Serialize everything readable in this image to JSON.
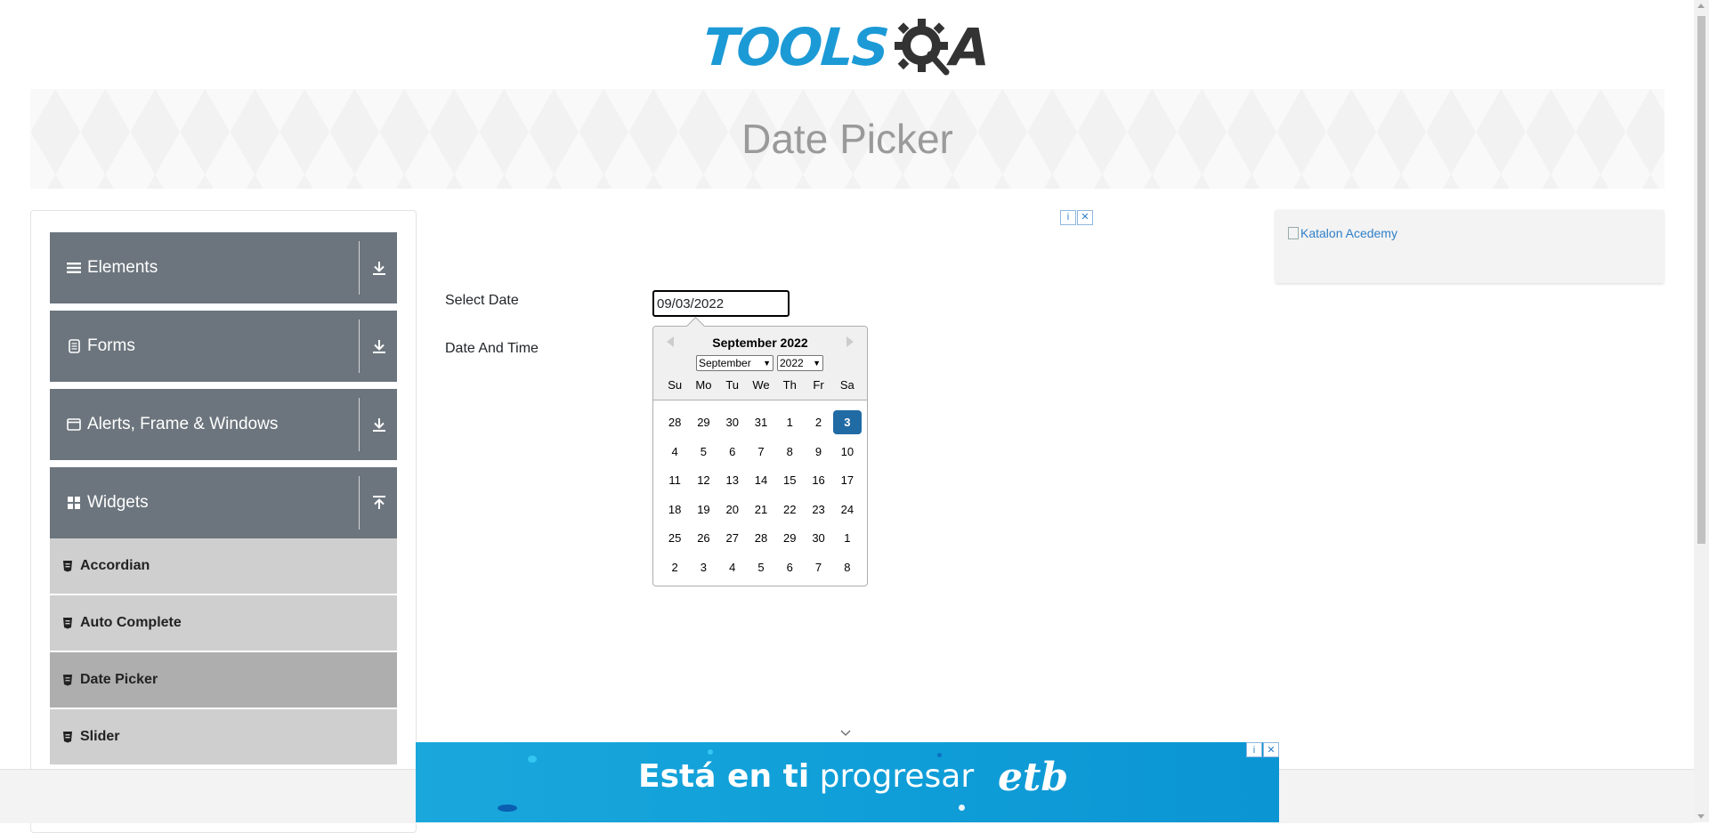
{
  "header": {
    "logo_text_left": "TOOLS",
    "logo_text_right": "A"
  },
  "banner": {
    "title": "Date Picker"
  },
  "sidebar": {
    "groups": [
      {
        "label": "Elements",
        "icon": "hamburger-icon",
        "expanded": false
      },
      {
        "label": "Forms",
        "icon": "document-icon",
        "expanded": false
      },
      {
        "label": "Alerts, Frame & Windows",
        "icon": "window-icon",
        "expanded": false
      },
      {
        "label": "Widgets",
        "icon": "widgets-icon",
        "expanded": true
      }
    ],
    "widget_items": [
      {
        "label": "Accordian",
        "active": false
      },
      {
        "label": "Auto Complete",
        "active": false
      },
      {
        "label": "Date Picker",
        "active": true
      },
      {
        "label": "Slider",
        "active": false
      }
    ]
  },
  "form": {
    "select_date_label": "Select Date",
    "date_time_label": "Date And Time",
    "date_value": "09/03/2022"
  },
  "calendar": {
    "title": "September 2022",
    "month_select": "September",
    "year_select": "2022",
    "weekdays": [
      "Su",
      "Mo",
      "Tu",
      "We",
      "Th",
      "Fr",
      "Sa"
    ],
    "weeks": [
      [
        "28",
        "29",
        "30",
        "31",
        "1",
        "2",
        "3"
      ],
      [
        "4",
        "5",
        "6",
        "7",
        "8",
        "9",
        "10"
      ],
      [
        "11",
        "12",
        "13",
        "14",
        "15",
        "16",
        "17"
      ],
      [
        "18",
        "19",
        "20",
        "21",
        "22",
        "23",
        "24"
      ],
      [
        "25",
        "26",
        "27",
        "28",
        "29",
        "30",
        "1"
      ],
      [
        "2",
        "3",
        "4",
        "5",
        "6",
        "7",
        "8"
      ]
    ],
    "selected_day": "3",
    "accent_color": "#216ba5"
  },
  "ads": {
    "side_ad_alt": "Katalon Acedemy",
    "bottom_ad_text_bold": "Está en ti",
    "bottom_ad_text_regular": "progresar",
    "bottom_ad_brand": "etb",
    "badge_info": "i",
    "badge_close": "✕"
  },
  "colors": {
    "sidebar_group": "#6c757d",
    "sub_item": "#cfcfcf",
    "sub_item_active": "#aeaeae",
    "logo_blue": "#1c9ad6"
  }
}
